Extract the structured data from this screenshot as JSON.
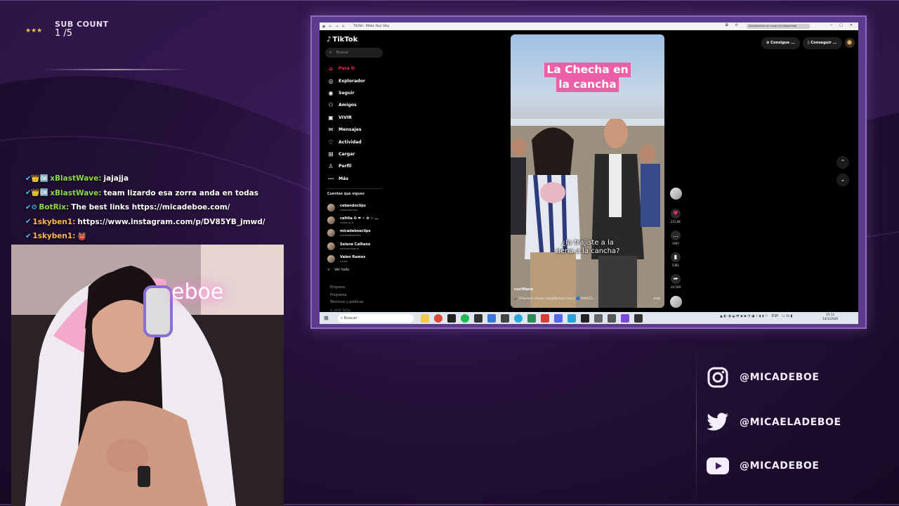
{
  "overlay": {
    "subcount": {
      "label": "SUB COUNT",
      "value": "1 /5",
      "stars": "★★★"
    },
    "chat": [
      {
        "badges": "✔👑🆗",
        "user": "xBlastWave:",
        "text": "jajajja",
        "color": "#8ed84c"
      },
      {
        "badges": "✔👑🆗",
        "user": "xBlastWave:",
        "text": "team lizardo esa zorra anda en todas",
        "color": "#8ed84c"
      },
      {
        "badges": "✔⚙",
        "user": "BotRix:",
        "text": "The best links https://micadeboe.com/",
        "color": "#8ed84c"
      },
      {
        "badges": "✔",
        "user": "1skyben1:",
        "text": "https://www.instagram.com/p/DV85YB_jmwd/",
        "color": "#ffb84a"
      },
      {
        "badges": "✔",
        "user": "1skyben1:",
        "text": "👹",
        "color": "#ffb84a"
      }
    ],
    "webcam_neon": "eboe",
    "socials": [
      {
        "icon": "instagram-icon",
        "handle": "@MICADEBOE"
      },
      {
        "icon": "twitter-icon",
        "handle": "@MICAELADEBOE"
      },
      {
        "icon": "youtube-icon",
        "handle": "@MICADEBOE"
      }
    ]
  },
  "browser": {
    "tab_title": "TikTok · Make Your Day",
    "update_notice": "Actualización en curso (no disponible)"
  },
  "tiktok": {
    "logo": "TikTok",
    "search_placeholder": "Buscar",
    "nav": [
      {
        "label": "Para ti",
        "icon": "home-icon",
        "active": true
      },
      {
        "label": "Explorador",
        "icon": "compass-icon"
      },
      {
        "label": "Seguir",
        "icon": "following-icon"
      },
      {
        "label": "Amigos",
        "icon": "friends-icon"
      },
      {
        "label": "VIVIR",
        "icon": "live-icon"
      },
      {
        "label": "Mensajes",
        "icon": "messages-icon"
      },
      {
        "label": "Actividad",
        "icon": "activity-icon"
      },
      {
        "label": "Cargar",
        "icon": "upload-icon"
      },
      {
        "label": "Perfil",
        "icon": "profile-icon"
      },
      {
        "label": "Más",
        "icon": "more-icon"
      }
    ],
    "following_title": "Cuentas que sigues",
    "accounts": [
      {
        "name": "cebandoclips",
        "handle": "cebandoclips"
      },
      {
        "name": "caltita ✪ ❤ ✧ ✿ ☆ …",
        "handle": "catalina_b"
      },
      {
        "name": "micadeboeclips",
        "handle": "micadeboeclips"
      },
      {
        "name": "Selene Calliano",
        "handle": "selenecalliano"
      },
      {
        "name": "Valen Ramos",
        "handle": "v4lxlx"
      }
    ],
    "see_all": "Ver todo",
    "footer": [
      "Empresa",
      "Programa",
      "Términos y políticas"
    ],
    "copyright": "© 2026 TikTok",
    "top_buttons": [
      "Consigue ...",
      "Conseguir ..."
    ],
    "video": {
      "caption_line1": "La Checha en",
      "caption_line2": "la cancha",
      "question_line1": "¿la trajiste a la",
      "question_line2": "nena a la cancha?",
      "user": "cocifiace",
      "desc": "🎤 Próximos shows con@Nahuel Iveira 🔵 MANZO...",
      "more": "más",
      "likes": "215,6K",
      "comments": "1997",
      "saves": "5381",
      "shares": "24.509"
    }
  },
  "taskbar": {
    "search": "Buscar",
    "tray": "ESP",
    "time": "15:11",
    "date": "14/1/2026"
  }
}
